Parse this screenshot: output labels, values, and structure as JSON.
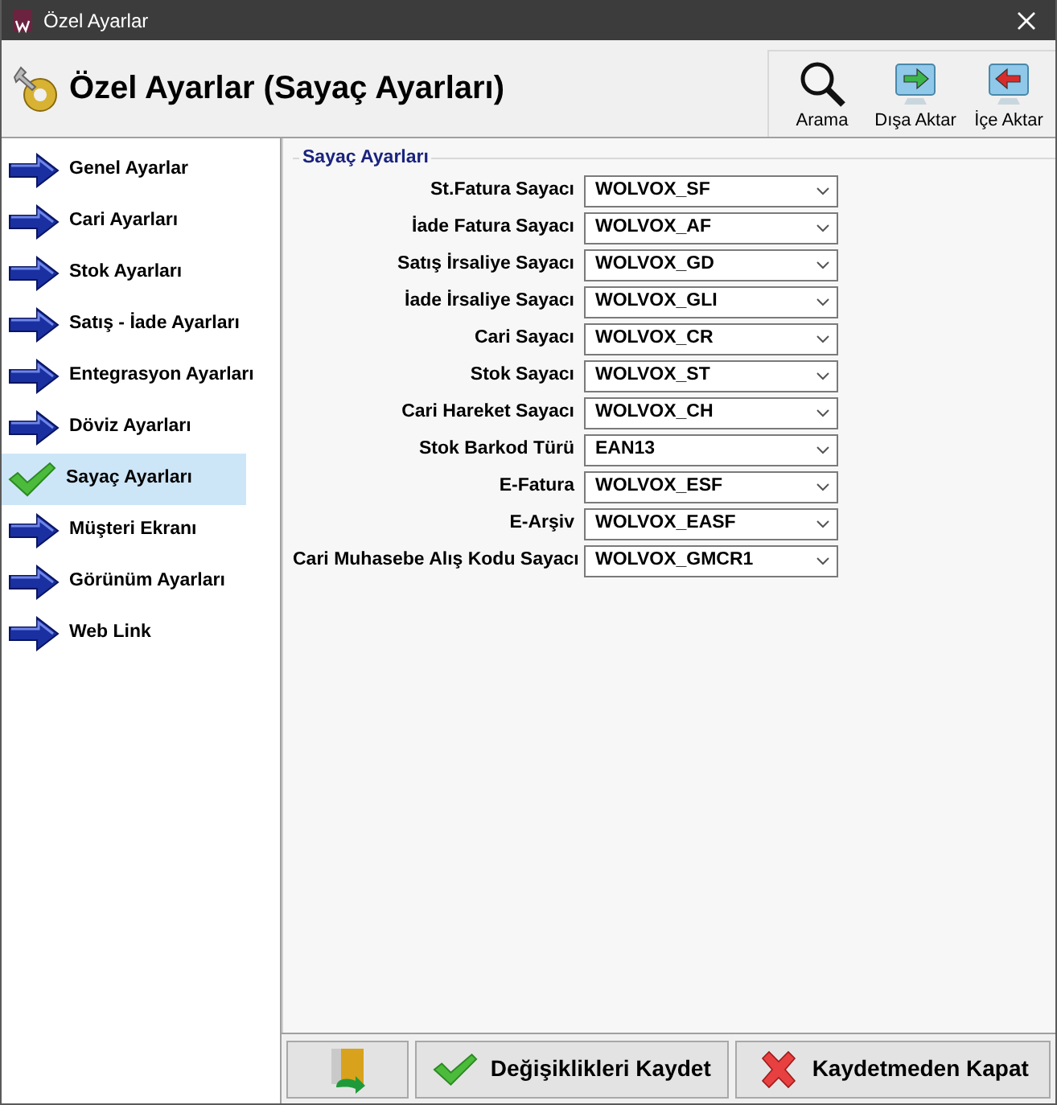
{
  "window": {
    "title": "Özel Ayarlar"
  },
  "header": {
    "title": "Özel Ayarlar (Sayaç Ayarları)",
    "tools": [
      {
        "label": "Arama",
        "kind": "search"
      },
      {
        "label": "Dışa Aktar",
        "kind": "export"
      },
      {
        "label": "İçe Aktar",
        "kind": "import"
      }
    ]
  },
  "sidebar": {
    "items": [
      {
        "label": "Genel Ayarlar",
        "selected": false
      },
      {
        "label": "Cari Ayarları",
        "selected": false
      },
      {
        "label": "Stok Ayarları",
        "selected": false
      },
      {
        "label": "Satış - İade Ayarları",
        "selected": false
      },
      {
        "label": "Entegrasyon Ayarları",
        "selected": false
      },
      {
        "label": "Döviz Ayarları",
        "selected": false
      },
      {
        "label": "Sayaç Ayarları",
        "selected": true
      },
      {
        "label": "Müşteri Ekranı",
        "selected": false
      },
      {
        "label": "Görünüm Ayarları",
        "selected": false
      },
      {
        "label": "Web Link",
        "selected": false
      }
    ]
  },
  "group": {
    "title": "Sayaç Ayarları",
    "fields": [
      {
        "label": "St.Fatura Sayacı",
        "value": "WOLVOX_SF"
      },
      {
        "label": "İade Fatura Sayacı",
        "value": "WOLVOX_AF"
      },
      {
        "label": "Satış İrsaliye Sayacı",
        "value": "WOLVOX_GD"
      },
      {
        "label": "İade İrsaliye Sayacı",
        "value": "WOLVOX_GLI"
      },
      {
        "label": "Cari Sayacı",
        "value": "WOLVOX_CR"
      },
      {
        "label": "Stok Sayacı",
        "value": "WOLVOX_ST"
      },
      {
        "label": "Cari Hareket Sayacı",
        "value": "WOLVOX_CH"
      },
      {
        "label": "Stok Barkod Türü",
        "value": "EAN13"
      },
      {
        "label": "E-Fatura",
        "value": "WOLVOX_ESF"
      },
      {
        "label": "E-Arşiv",
        "value": "WOLVOX_EASF"
      },
      {
        "label": "Cari Muhasebe Alış Kodu Sayacı",
        "value": "WOLVOX_GMCR1"
      }
    ]
  },
  "footer": {
    "buttons": [
      {
        "kind": "exit"
      },
      {
        "kind": "save",
        "label": "Değişiklikleri Kaydet"
      },
      {
        "kind": "cancel",
        "label": "Kaydetmeden Kapat"
      }
    ]
  }
}
